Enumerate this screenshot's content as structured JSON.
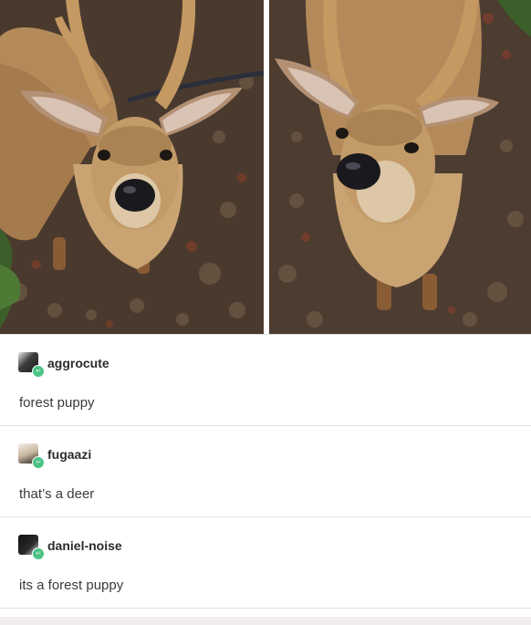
{
  "post": {
    "images": [
      {
        "icon": "deer-photo-left"
      },
      {
        "icon": "deer-photo-right"
      }
    ]
  },
  "replies": [
    {
      "username": "aggrocute",
      "text": "forest puppy",
      "avatar_icon": "dark-avatar-icon"
    },
    {
      "username": "fugaazi",
      "text": "that’s a deer",
      "avatar_icon": "light-avatar-icon"
    },
    {
      "username": "daniel-noise",
      "text": "its a forest puppy",
      "avatar_icon": "black-avatar-icon"
    }
  ],
  "colors": {
    "badge": "#4cc386",
    "username": "#2b2b2b",
    "reply_text": "#3a3a3a",
    "divider": "#e4e4e4"
  }
}
